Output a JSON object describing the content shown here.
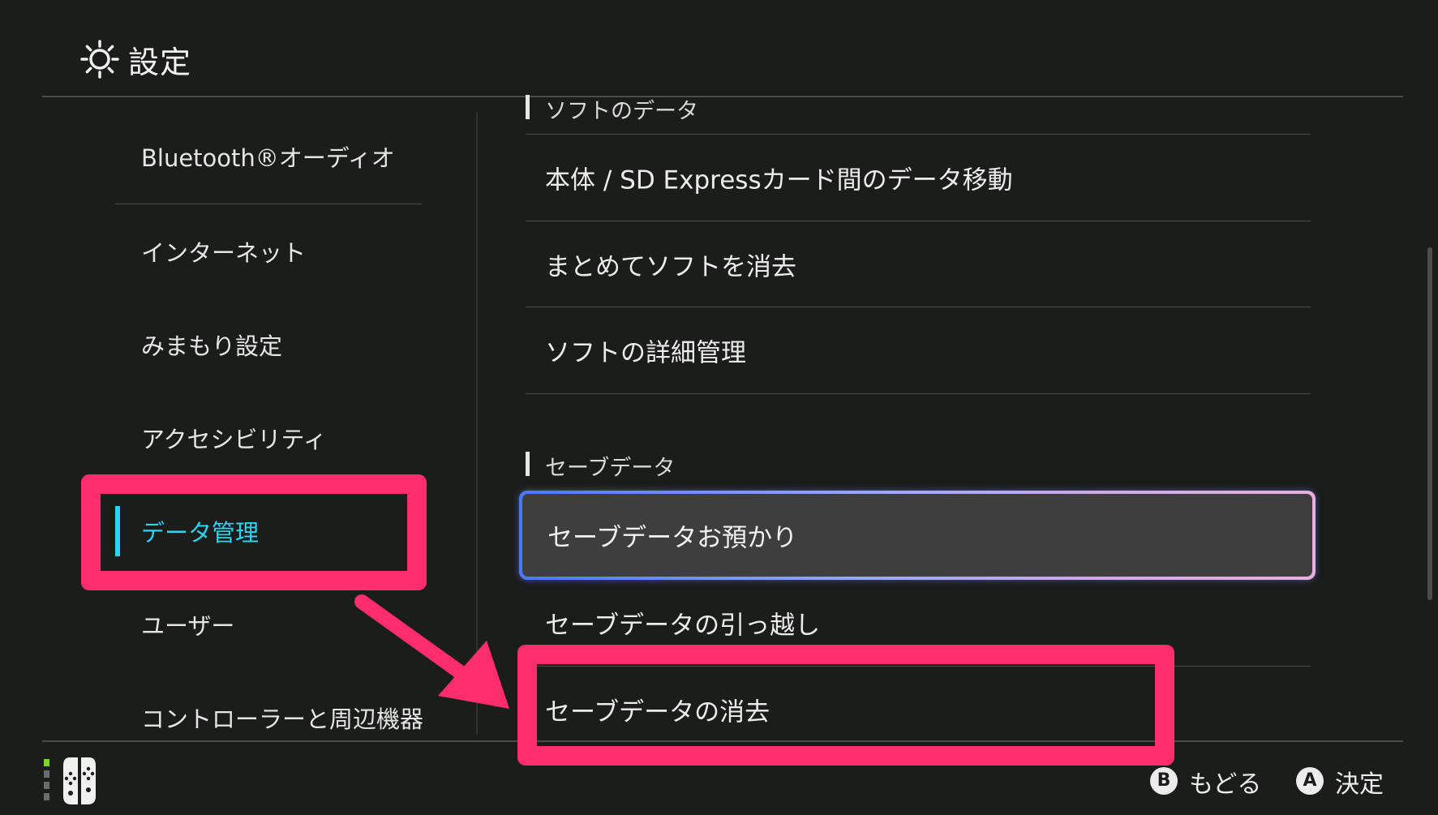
{
  "header": {
    "title": "設定",
    "icon": "gear-icon"
  },
  "sidebar": {
    "items": [
      {
        "label": "Bluetooth®オーディオ",
        "selected": false
      },
      {
        "label": "インターネット",
        "selected": false
      },
      {
        "label": "みまもり設定",
        "selected": false
      },
      {
        "label": "アクセシビリティ",
        "selected": false
      },
      {
        "label": "データ管理",
        "selected": true
      },
      {
        "label": "ユーザー",
        "selected": false
      },
      {
        "label": "コントローラーと周辺機器",
        "selected": false
      }
    ],
    "accent_color": "#2fd3f0"
  },
  "main": {
    "sections": [
      {
        "header": "ソフトのデータ",
        "items": [
          {
            "label": "本体 / SD Expressカード間のデータ移動"
          },
          {
            "label": "まとめてソフトを消去"
          },
          {
            "label": "ソフトの詳細管理"
          }
        ]
      },
      {
        "header": "セーブデータ",
        "items": [
          {
            "label": "セーブデータお預かり",
            "focused": true
          },
          {
            "label": "セーブデータの引っ越し"
          },
          {
            "label": "セーブデータの消去"
          }
        ]
      }
    ]
  },
  "footer": {
    "left_icon": "joycon-icon",
    "hints": [
      {
        "button": "B",
        "label": "もどる"
      },
      {
        "button": "A",
        "label": "決定"
      }
    ]
  },
  "annotations": {
    "color": "#ff2d6e"
  }
}
